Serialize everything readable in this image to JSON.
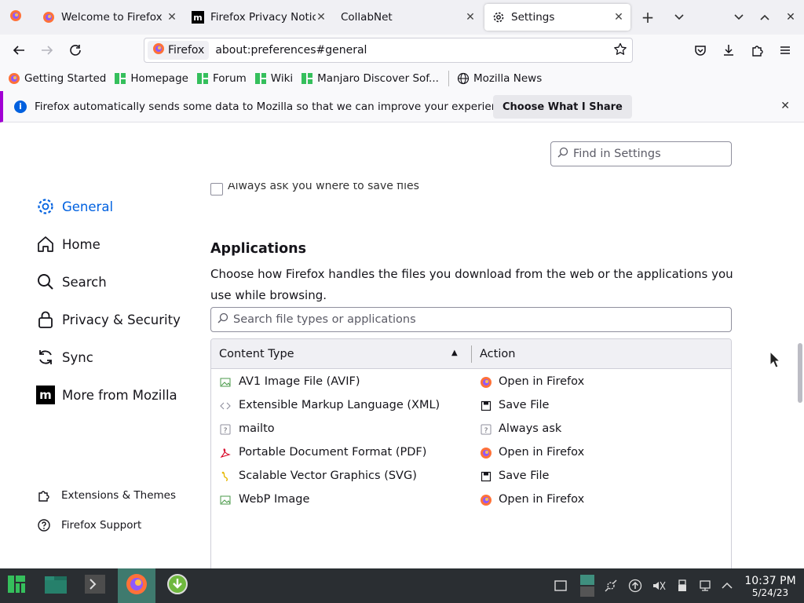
{
  "tabs": [
    {
      "title": "Welcome to Firefox",
      "icon": "firefox-icon"
    },
    {
      "title": "Firefox Privacy Notice",
      "icon": "mozilla-m-icon"
    },
    {
      "title": "CollabNet",
      "icon": "none"
    },
    {
      "title": "Settings",
      "icon": "gear-icon"
    }
  ],
  "urlbar": {
    "identity_label": "Firefox",
    "url": "about:preferences#general"
  },
  "bookmarks": [
    {
      "label": "Getting Started",
      "icon": "firefox-icon"
    },
    {
      "label": "Homepage",
      "icon": "manjaro-icon"
    },
    {
      "label": "Forum",
      "icon": "manjaro-icon"
    },
    {
      "label": "Wiki",
      "icon": "manjaro-icon"
    },
    {
      "label": "Manjaro Discover Sof...",
      "icon": "manjaro-icon"
    },
    {
      "label": "Mozilla News",
      "icon": "globe-icon"
    }
  ],
  "notification": {
    "message": "Firefox automatically sends some data to Mozilla so that we can improve your experience.",
    "button": "Choose What I Share"
  },
  "search": {
    "find_placeholder": "Find in Settings",
    "types_placeholder": "Search file types or applications"
  },
  "sidebar": {
    "items": [
      {
        "label": "General",
        "icon": "gear-icon"
      },
      {
        "label": "Home",
        "icon": "home-icon"
      },
      {
        "label": "Search",
        "icon": "search-icon"
      },
      {
        "label": "Privacy & Security",
        "icon": "lock-icon"
      },
      {
        "label": "Sync",
        "icon": "sync-icon"
      },
      {
        "label": "More from Mozilla",
        "icon": "mozilla-m-icon"
      }
    ],
    "footer": [
      {
        "label": "Extensions & Themes",
        "icon": "puzzle-icon"
      },
      {
        "label": "Firefox Support",
        "icon": "help-icon"
      }
    ]
  },
  "main": {
    "cutoff_text": "Always ask you where to save files",
    "applications_title": "Applications",
    "applications_desc": "Choose how Firefox handles the files you download from the web or the applications you use while browsing.",
    "table": {
      "headers": [
        "Content Type",
        "Action"
      ],
      "rows": [
        {
          "type": "AV1 Image File (AVIF)",
          "type_icon": "image-icon",
          "action": "Open in Firefox",
          "action_icon": "firefox-icon"
        },
        {
          "type": "Extensible Markup Language (XML)",
          "type_icon": "code-icon",
          "action": "Save File",
          "action_icon": "save-icon"
        },
        {
          "type": "mailto",
          "type_icon": "question-icon",
          "action": "Always ask",
          "action_icon": "question-icon"
        },
        {
          "type": "Portable Document Format (PDF)",
          "type_icon": "pdf-icon",
          "action": "Open in Firefox",
          "action_icon": "firefox-icon"
        },
        {
          "type": "Scalable Vector Graphics (SVG)",
          "type_icon": "svg-icon",
          "action": "Save File",
          "action_icon": "save-icon"
        },
        {
          "type": "WebP Image",
          "type_icon": "image-icon",
          "action": "Open in Firefox",
          "action_icon": "firefox-icon"
        }
      ]
    }
  },
  "taskbar": {
    "time": "10:37 PM",
    "date": "5/24/23"
  },
  "colors": {
    "accent": "#0061e0",
    "notification_bar": "#a200d4",
    "taskbar": "#2a2e32"
  }
}
